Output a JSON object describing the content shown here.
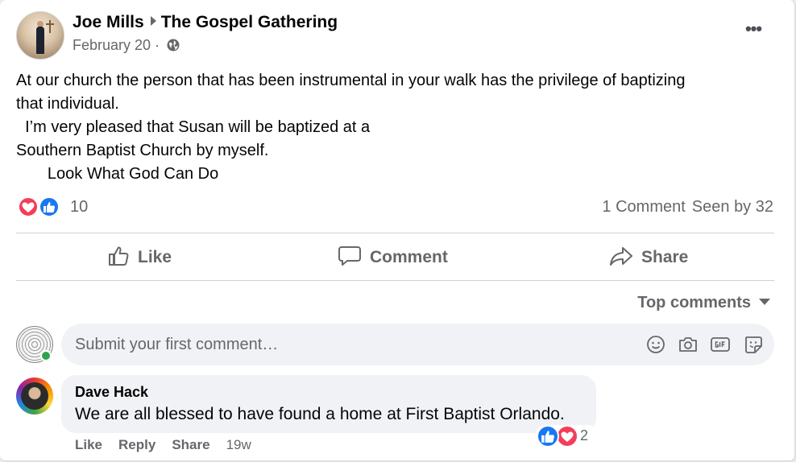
{
  "post": {
    "author": "Joe Mills",
    "group": "The Gospel Gathering",
    "date": "February 20",
    "date_separator": " · ",
    "text": "At our church the person that has been instrumental in your walk has the privilege of baptizing\nthat individual.\n  I’m very pleased that Susan will be baptized at a \nSouthern Baptist Church by myself.\n       Look What God Can Do",
    "reaction_count": "10",
    "comments_count_label": "1 Comment",
    "seen_by_label": "Seen by 32"
  },
  "actions": {
    "like": "Like",
    "comment": "Comment",
    "share": "Share"
  },
  "sort": {
    "label": "Top comments"
  },
  "composer": {
    "placeholder": "Submit your first comment…"
  },
  "comments": [
    {
      "author": "Dave Hack",
      "text": "We are all blessed to have found a home at First Baptist Orlando.",
      "like_label": "Like",
      "reply_label": "Reply",
      "share_label": "Share",
      "time": "19w",
      "reaction_count": "2"
    }
  ],
  "colors": {
    "like_blue": "#1877f2",
    "love_red": "#f33e58",
    "online_green": "#31a24c",
    "secondary_text": "#65676b"
  }
}
